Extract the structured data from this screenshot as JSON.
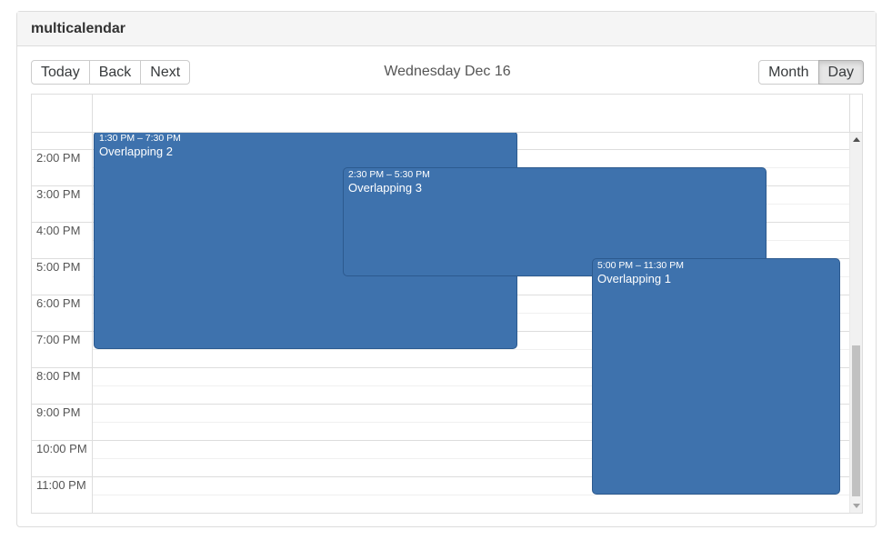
{
  "panel": {
    "title": "multicalendar"
  },
  "toolbar": {
    "nav_buttons": [
      "Today",
      "Back",
      "Next"
    ],
    "label": "Wednesday Dec 16",
    "view_buttons": [
      "Month",
      "Day"
    ],
    "active_view": "Day"
  },
  "time_slots": [
    "2:00 PM",
    "3:00 PM",
    "4:00 PM",
    "5:00 PM",
    "6:00 PM",
    "7:00 PM",
    "8:00 PM",
    "9:00 PM",
    "10:00 PM",
    "11:00 PM"
  ],
  "events": [
    {
      "time": "1:30 PM – 7:30 PM",
      "title": "Overlapping 2",
      "start_hour": 13.5,
      "end_hour": 19.5,
      "column": 0
    },
    {
      "time": "2:30 PM – 5:30 PM",
      "title": "Overlapping 3",
      "start_hour": 14.5,
      "end_hour": 17.5,
      "column": 1
    },
    {
      "time": "5:00 PM – 11:30 PM",
      "title": "Overlapping 1",
      "start_hour": 17.0,
      "end_hour": 23.5,
      "column": 2
    }
  ],
  "colors": {
    "event_bg": "#3e72ad",
    "event_border": "#2c5a8f",
    "grid": "#dddddd"
  }
}
